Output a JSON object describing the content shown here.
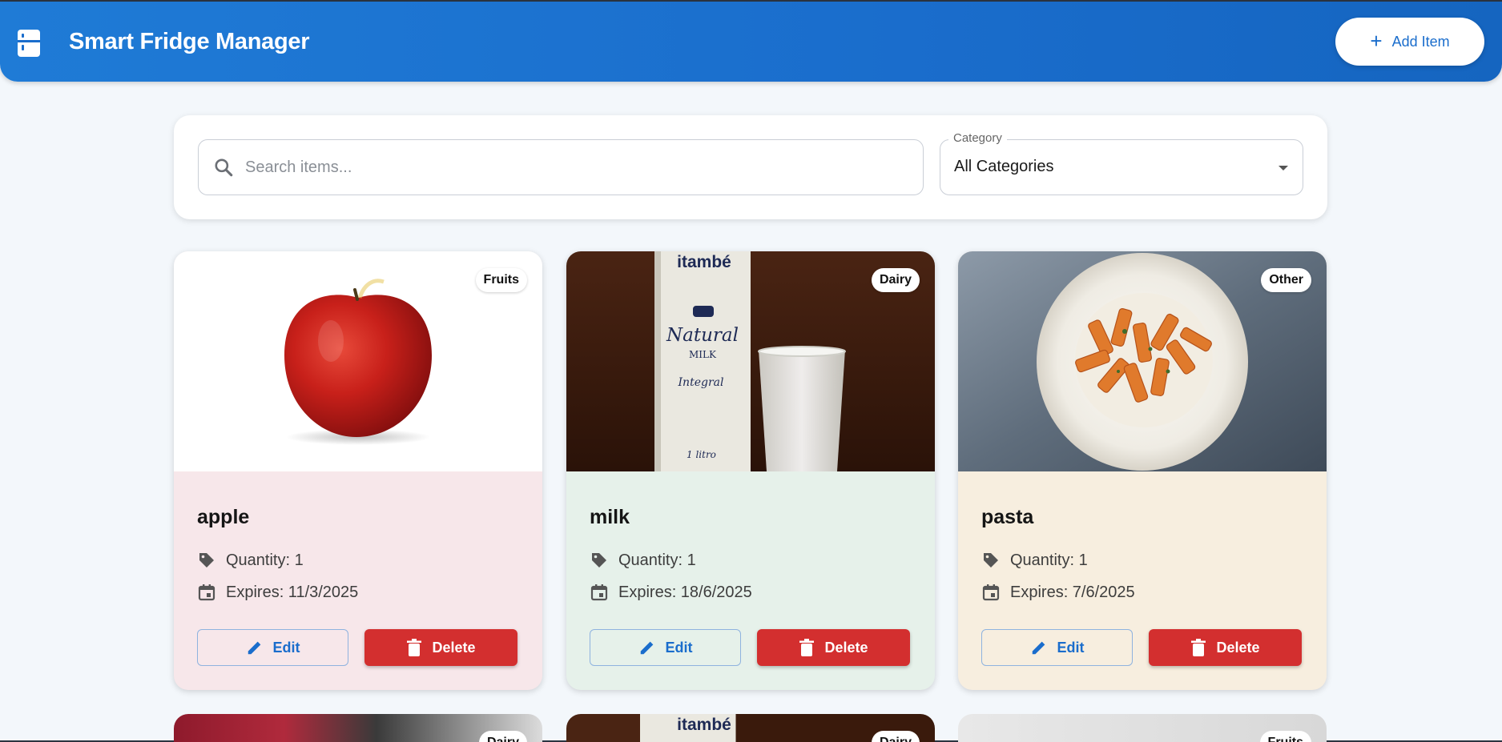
{
  "header": {
    "title": "Smart Fridge Manager",
    "add_button_label": "Add Item",
    "logo_icon": "fridge-icon"
  },
  "filters": {
    "search_placeholder": "Search items...",
    "search_value": "",
    "category_label": "Category",
    "category_value": "All Categories"
  },
  "colors": {
    "header_blue": "#1a6dcc",
    "delete_red": "#d32f2f",
    "card_fruits": "#f7e7ea",
    "card_dairy": "#e6f1ea",
    "card_other": "#f7eedf"
  },
  "items": [
    {
      "name": "apple",
      "category": "Fruits",
      "quantity": "Quantity: 1",
      "expires": "Expires: 11/3/2025",
      "edit_label": "Edit",
      "delete_label": "Delete"
    },
    {
      "name": "milk",
      "category": "Dairy",
      "quantity": "Quantity: 1",
      "expires": "Expires: 18/6/2025",
      "edit_label": "Edit",
      "delete_label": "Delete",
      "image_text": {
        "brand": "itambé",
        "line1": "Natural",
        "line2": "MILK",
        "line3": "Integral",
        "volume": "1 litro"
      }
    },
    {
      "name": "pasta",
      "category": "Other",
      "quantity": "Quantity: 1",
      "expires": "Expires: 7/6/2025",
      "edit_label": "Edit",
      "delete_label": "Delete"
    }
  ],
  "next_row": [
    {
      "category": "Dairy"
    },
    {
      "category": "Dairy",
      "brand": "itambé"
    },
    {
      "category": "Fruits"
    }
  ]
}
